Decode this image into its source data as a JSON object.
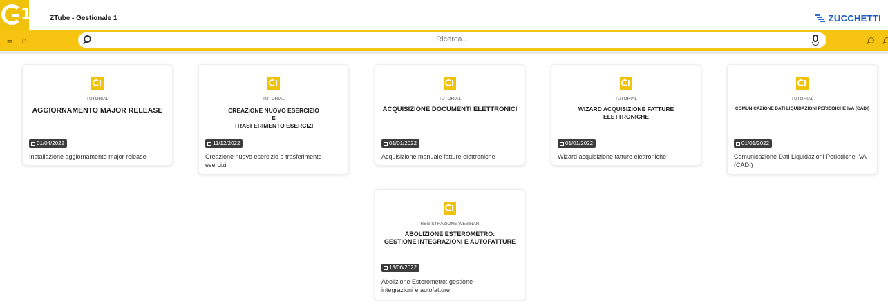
{
  "app": {
    "title": "ZTube - Gestionale 1",
    "brand": "ZUCCHETTI",
    "accent": "#f7c411",
    "brand_color": "#1a5bbf"
  },
  "search": {
    "placeholder": "Ricerca..."
  },
  "icons": {
    "menu": "≡",
    "home": "⌂"
  },
  "cards": [
    {
      "category": "TUTORIAL",
      "title": "AGGIORNAMENTO MAJOR RELEASE",
      "date": "01/04/2022",
      "description": "Installazione aggiornamento major release"
    },
    {
      "category": "TUTORIAL",
      "title_lines": [
        "CREAZIONE NUOVO ESERCIZIO",
        "E",
        "TRASFERIMENTO ESERCIZI"
      ],
      "date": "11/12/2022",
      "description": "Creazione nuovo esercizio e trasferimento esercizi"
    },
    {
      "category": "TUTORIAL",
      "title": "ACQUISIZIONE DOCUMENTI ELETTRONICI",
      "date": "01/01/2022",
      "description": "Acquisizione manuale fatture elettroniche"
    },
    {
      "category": "TUTORIAL",
      "title": "WIZARD ACQUISIZIONE FATTURE ELETTRONICHE",
      "date": "01/01/2022",
      "description": "Wizard acquisizione fatture elettroniche"
    },
    {
      "category": "TUTORIAL",
      "title": "COMUNICAZIONE DATI LIQUIDAZIONI PERIODICHE IVA (CADI)",
      "date": "01/01/2022",
      "description": "Comunicazione Dati Liquidazioni Periodiche IVA (CADI)"
    },
    {
      "category": "REGISTRAZIONE WEBINAR",
      "title_lines": [
        "ABOLIZIONE ESTEROMETRO:",
        "GESTIONE INTEGRAZIONI E AUTOFATTURE"
      ],
      "date": "13/06/2022",
      "description": "Abolizione Esterometro: gestione integrazioni e autofatture"
    }
  ]
}
